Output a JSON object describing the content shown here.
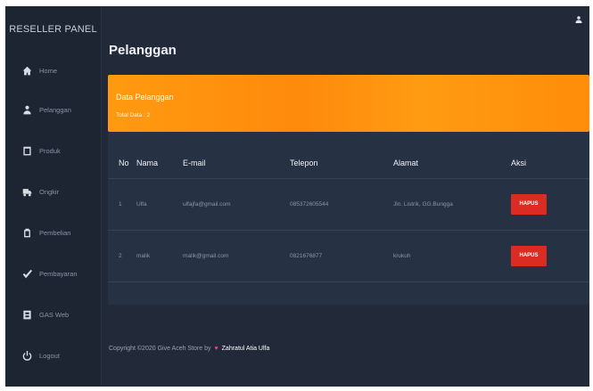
{
  "sidebar": {
    "brand": "RESELLER PANEL",
    "items": [
      {
        "label": "Home",
        "icon": "home-icon"
      },
      {
        "label": "Pelanggan",
        "icon": "user-icon"
      },
      {
        "label": "Produk",
        "icon": "window-icon"
      },
      {
        "label": "Ongkir",
        "icon": "truck-icon"
      },
      {
        "label": "Pembelian",
        "icon": "clipboard-icon"
      },
      {
        "label": "Pembayaran",
        "icon": "check-icon"
      },
      {
        "label": "GAS Web",
        "icon": "database-icon"
      },
      {
        "label": "Logout",
        "icon": "power-icon"
      }
    ]
  },
  "header": {
    "title": "Pelanggan"
  },
  "card": {
    "title": "Data Pelanggan",
    "subtitle": "Total Data : 2"
  },
  "table": {
    "headers": [
      "No",
      "Nama",
      "E-mail",
      "Telepon",
      "Alamat",
      "Aksi"
    ],
    "rows": [
      {
        "no": "1",
        "nama": "Ulfa",
        "email": "ulfajfa@gmail.com",
        "telepon": "085372605544",
        "alamat": "Jln. Listrik, GG.Bungga",
        "aksi": "HAPUS"
      },
      {
        "no": "2",
        "nama": "malik",
        "email": "malik@gmail.com",
        "telepon": "0821676877",
        "alamat": "krukuh",
        "aksi": "HAPUS"
      }
    ]
  },
  "footer": {
    "text": "Copyright ©2020 Give Aceh Store by",
    "heart": "♥",
    "author": "Zahratul Atia Ulfa"
  },
  "colors": {
    "accent": "#ff9200",
    "danger": "#dc2b22",
    "background": "#222a3a",
    "sidebar": "#1d2532"
  }
}
